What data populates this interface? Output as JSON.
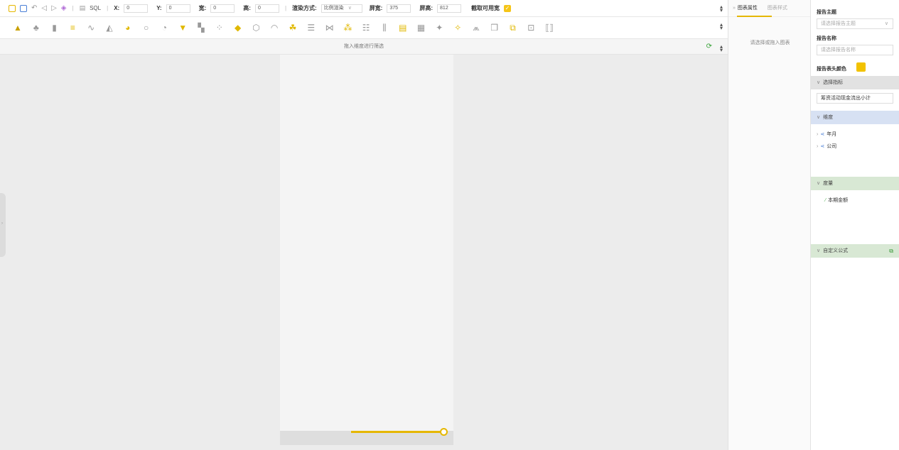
{
  "toolbar": {
    "icons": [
      "save-icon",
      "save-as-icon",
      "undo-icon",
      "back-icon",
      "forward-icon",
      "layers-icon",
      "sql-icon"
    ],
    "sql_label": "SQL",
    "x_label": "X:",
    "x_value": "0",
    "y_label": "Y:",
    "y_value": "0",
    "width_label": "宽:",
    "width_value": "0",
    "height_label": "高:",
    "height_value": "0",
    "render_label": "渲染方式:",
    "render_value": "比例渲染",
    "screen_width_label": "屏宽:",
    "screen_width_value": "375",
    "screen_height_label": "屏高:",
    "screen_height_value": "812",
    "cut_label": "截取可用宽",
    "cut_checked": true
  },
  "chart_icons": [
    {
      "name": "chart-type-icon-1",
      "glyph": "▲"
    },
    {
      "name": "chart-type-icon-2",
      "glyph": "♣"
    },
    {
      "name": "chart-type-icon-3",
      "glyph": "▮"
    },
    {
      "name": "chart-type-icon-4",
      "glyph": "≡"
    },
    {
      "name": "chart-type-icon-5",
      "glyph": "∿"
    },
    {
      "name": "chart-type-icon-6",
      "glyph": "◭"
    },
    {
      "name": "chart-type-icon-7",
      "glyph": "◕"
    },
    {
      "name": "chart-type-icon-8",
      "glyph": "○"
    },
    {
      "name": "chart-type-icon-9",
      "glyph": "◔"
    },
    {
      "name": "chart-type-icon-10",
      "glyph": "▼"
    },
    {
      "name": "chart-type-icon-11",
      "glyph": "▚"
    },
    {
      "name": "chart-type-icon-12",
      "glyph": "⁘"
    },
    {
      "name": "chart-type-icon-13",
      "glyph": "◆"
    },
    {
      "name": "chart-type-icon-14",
      "glyph": "⬡"
    },
    {
      "name": "chart-type-icon-15",
      "glyph": "◠"
    },
    {
      "name": "chart-type-icon-16",
      "glyph": "☘"
    },
    {
      "name": "chart-type-icon-17",
      "glyph": "☰"
    },
    {
      "name": "chart-type-icon-18",
      "glyph": "⋈"
    },
    {
      "name": "chart-type-icon-19",
      "glyph": "⁂"
    },
    {
      "name": "chart-type-icon-20",
      "glyph": "☷"
    },
    {
      "name": "chart-type-icon-21",
      "glyph": "⫼"
    },
    {
      "name": "chart-type-icon-22",
      "glyph": "▤"
    },
    {
      "name": "chart-type-icon-23",
      "glyph": "▦"
    },
    {
      "name": "chart-type-icon-24",
      "glyph": "✦"
    },
    {
      "name": "chart-type-icon-25",
      "glyph": "✧"
    },
    {
      "name": "chart-type-icon-26",
      "glyph": "⩕"
    },
    {
      "name": "chart-type-icon-27",
      "glyph": "❒"
    },
    {
      "name": "chart-type-icon-28",
      "glyph": "⧉"
    },
    {
      "name": "chart-type-icon-29",
      "glyph": "⊡"
    },
    {
      "name": "chart-type-icon-30",
      "glyph": "⟦⟧"
    }
  ],
  "filter": {
    "placeholder": "拖入维度进行筛选"
  },
  "prop_panel": {
    "tab_active": "图表属性",
    "tab_inactive": "图表样式",
    "hint": "请选择或拖入图表"
  },
  "report": {
    "theme_label": "报告主题",
    "theme_placeholder": "请选择报告主题",
    "name_label": "报告名称",
    "name_placeholder": "请选择报告名称",
    "header_color_label": "报告表头颜色",
    "header_color": "#f2c200"
  },
  "sections": {
    "indicator": "选择指标",
    "indicator_value": "筹资活动现金流出小计",
    "dimension": "维度",
    "dimensions": [
      "年月",
      "公司"
    ],
    "measure": "度量",
    "measures": [
      "本期金额"
    ],
    "formula": "自定义公式"
  },
  "colors": {
    "accent": "#e5b700",
    "canvas_bg": "#ececec"
  }
}
